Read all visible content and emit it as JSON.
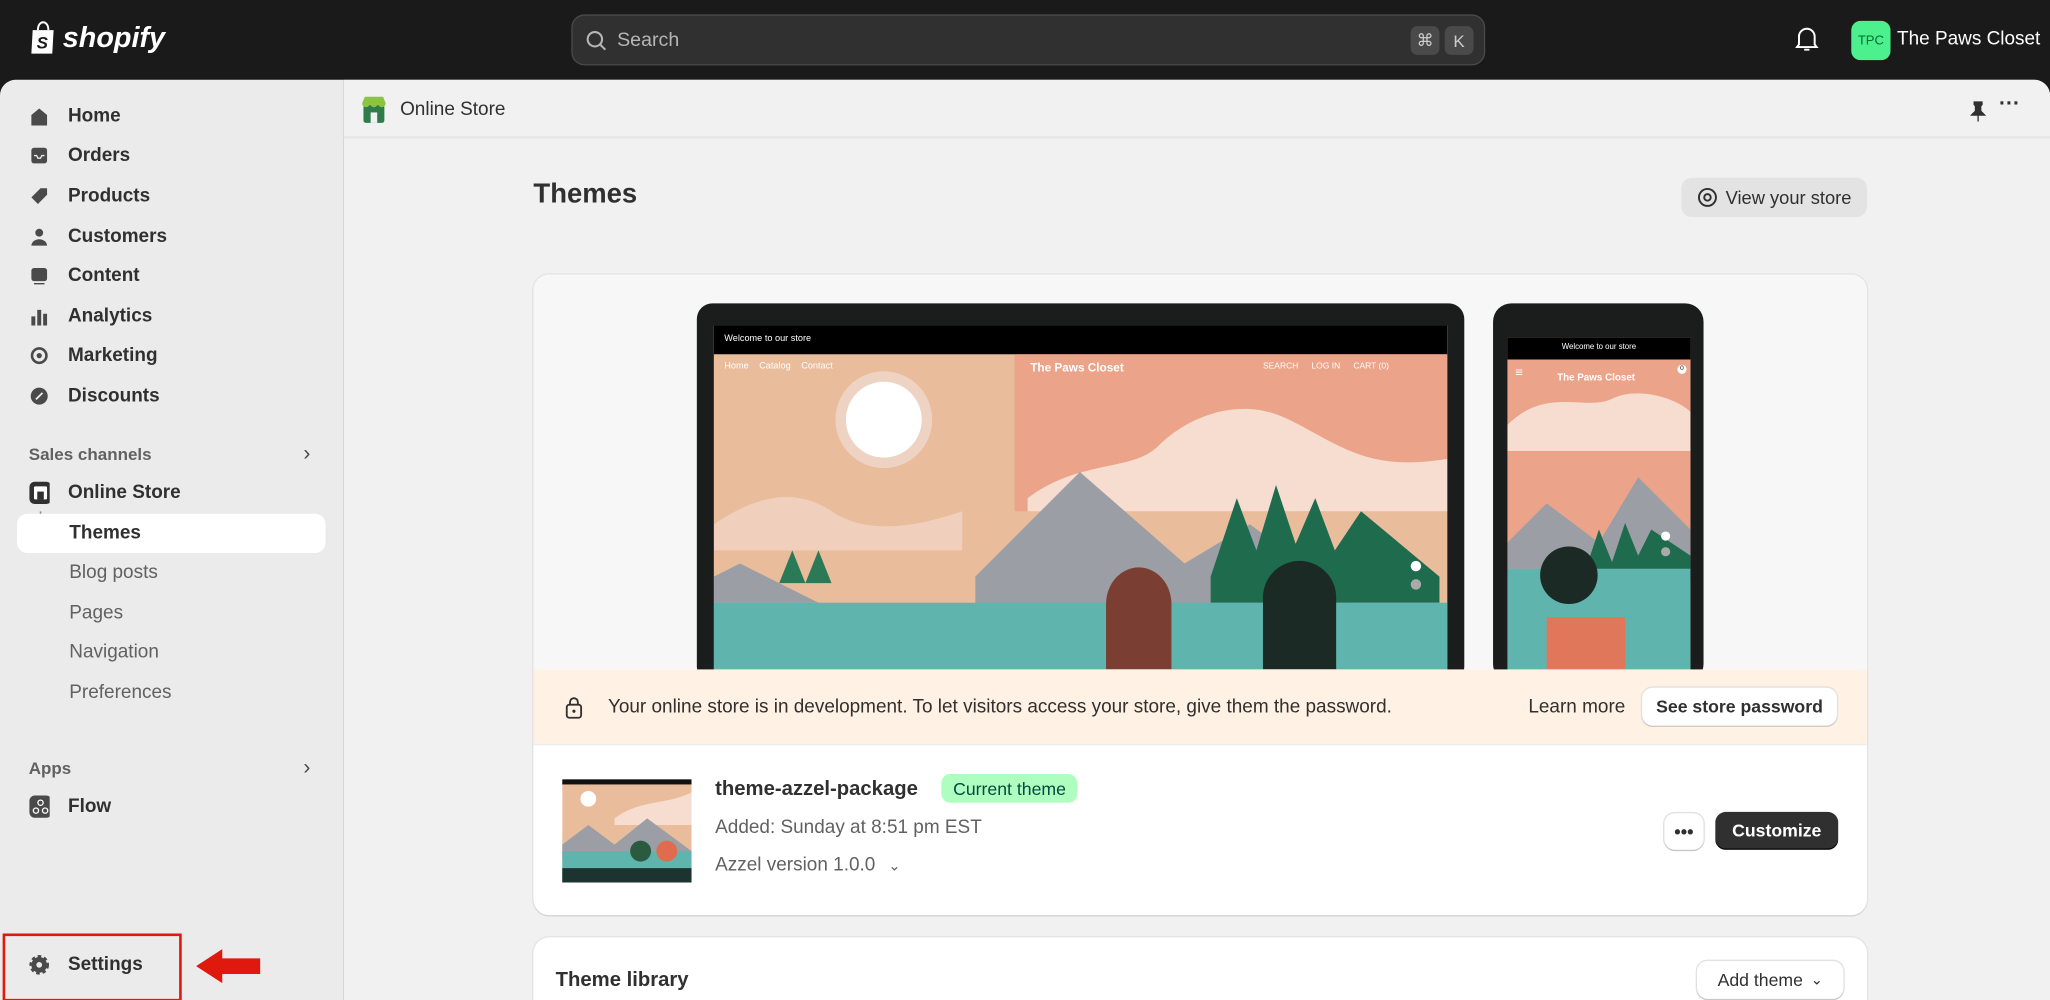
{
  "topbar": {
    "brand": "shopify",
    "search_placeholder": "Search",
    "shortcut_keys": [
      "⌘",
      "K"
    ],
    "avatar_initials": "TPC",
    "store_name": "The Paws Closet",
    "avatar_color": "#4cf18e"
  },
  "sidebar": {
    "items": [
      {
        "label": "Home",
        "icon": "home-icon"
      },
      {
        "label": "Orders",
        "icon": "inbox-icon"
      },
      {
        "label": "Products",
        "icon": "tag-icon"
      },
      {
        "label": "Customers",
        "icon": "person-icon"
      },
      {
        "label": "Content",
        "icon": "image-icon"
      },
      {
        "label": "Analytics",
        "icon": "bar-chart-icon"
      },
      {
        "label": "Marketing",
        "icon": "target-icon"
      },
      {
        "label": "Discounts",
        "icon": "discount-icon"
      }
    ],
    "sales_channels_label": "Sales channels",
    "online_store": "Online Store",
    "online_store_sub": [
      "Themes",
      "Blog posts",
      "Pages",
      "Navigation",
      "Preferences"
    ],
    "selected": "Themes",
    "apps_label": "Apps",
    "flow": "Flow",
    "settings": "Settings",
    "highlight_color": "#e0190f"
  },
  "header": {
    "title": "Online Store"
  },
  "page": {
    "title": "Themes",
    "view_store": "View your store"
  },
  "preview": {
    "announcement": "Welcome to our store",
    "store_title": "The Paws Closet",
    "nav": [
      "Home",
      "Catalog",
      "Contact"
    ],
    "actions": [
      "SEARCH",
      "LOG IN",
      "CART (0)"
    ],
    "cart_count": "0"
  },
  "banner": {
    "text": "Your online store is in development. To let visitors access your store, give them the password.",
    "learn_more": "Learn more",
    "see_password": "See store password"
  },
  "theme": {
    "name": "theme-azzel-package",
    "badge": "Current theme",
    "added": "Added: Sunday at 8:51 pm EST",
    "version": "Azzel version 1.0.0",
    "customize": "Customize"
  },
  "library": {
    "title": "Theme library",
    "add_theme": "Add theme"
  }
}
